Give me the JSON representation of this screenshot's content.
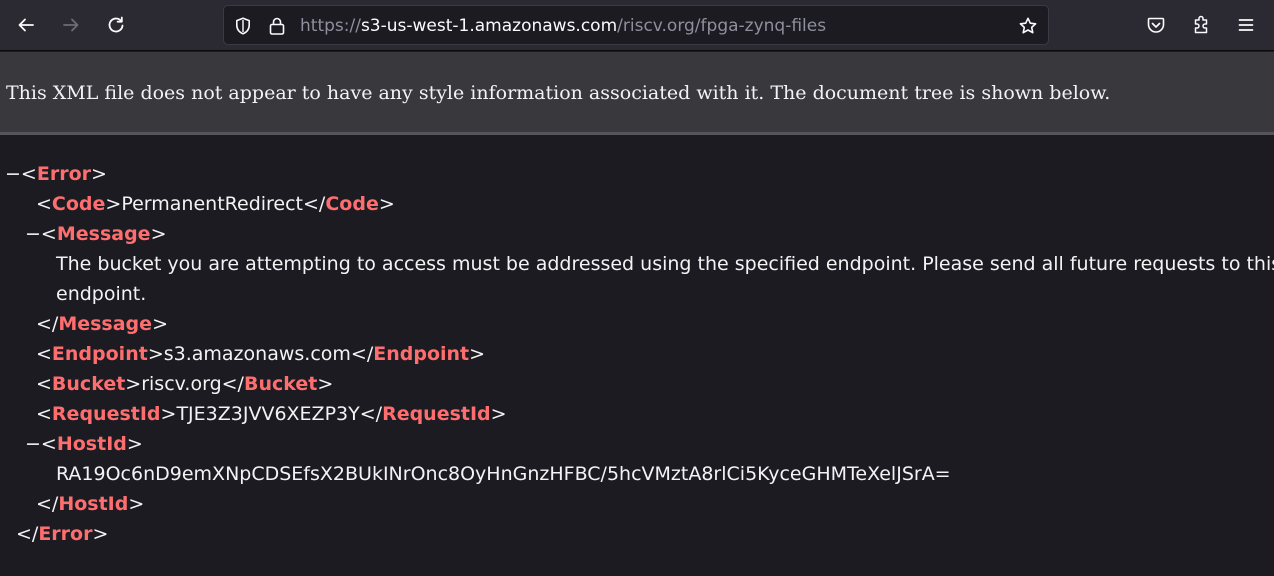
{
  "toolbar": {
    "back_icon": "back-arrow-icon",
    "forward_icon": "forward-arrow-icon",
    "reload_icon": "reload-icon",
    "url": {
      "prefix": "https://",
      "host": "s3-us-west-1.amazonaws.com",
      "path": "/riscv.org/fpga-zynq-files"
    },
    "right_icons": [
      "pocket-icon",
      "extensions-icon",
      "menu-icon"
    ]
  },
  "banner": {
    "text": "This XML file does not appear to have any style information associated with it. The document tree is shown below."
  },
  "xml": {
    "fold_marker": "−",
    "root_tag": "Error",
    "code": {
      "tag": "Code",
      "value": "PermanentRedirect"
    },
    "message": {
      "tag": "Message",
      "line1": "The bucket you are attempting to access must be addressed using the specified endpoint. Please send all future requests to this",
      "line2": "endpoint."
    },
    "endpoint": {
      "tag": "Endpoint",
      "value": "s3.amazonaws.com"
    },
    "bucket": {
      "tag": "Bucket",
      "value": "riscv.org"
    },
    "request_id": {
      "tag": "RequestId",
      "value": "TJE3Z3JVV6XEZP3Y"
    },
    "host_id": {
      "tag": "HostId",
      "value": "RA19Oc6nD9emXNpCDSEfsX2BUkINrOnc8OyHnGnzHFBC/5hcVMztA8rlCi5KyceGHMTeXelJSrA="
    }
  }
}
